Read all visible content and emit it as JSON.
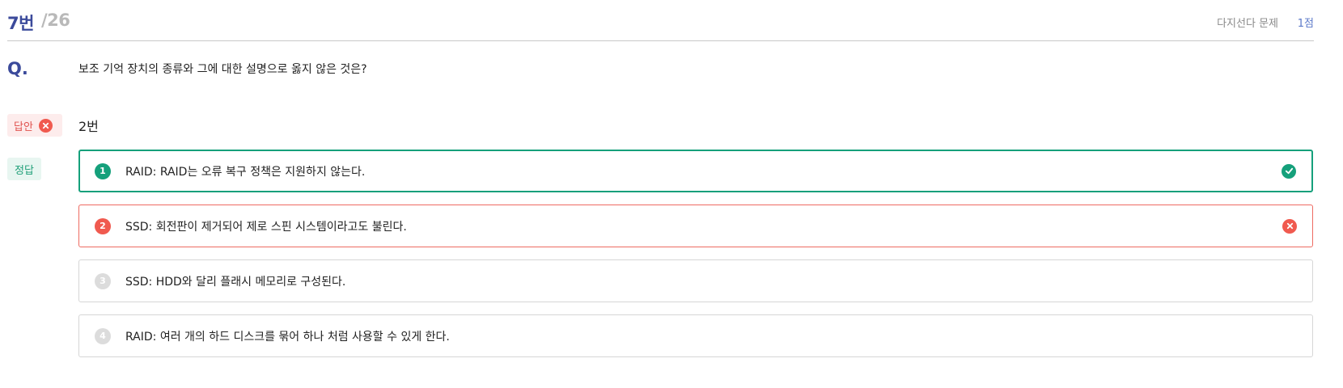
{
  "header": {
    "question_number": "7번",
    "total": "/26",
    "question_type": "다지선다 문제",
    "points": "1점"
  },
  "question": {
    "label": "Q.",
    "text": "보조 기억 장치의 종류와 그에 대한 설명으로 옳지 않은 것은?"
  },
  "answer": {
    "label": "답안",
    "value": "2번",
    "status_icon": "x-circle-icon"
  },
  "correct": {
    "label": "정답"
  },
  "choices": [
    {
      "number": "1",
      "text": "RAID: RAID는 오류 복구 정책은 지원하지 않는다.",
      "state": "correct",
      "icon": "check-circle-icon"
    },
    {
      "number": "2",
      "text": "SSD: 회전판이 제거되어 제로 스핀 시스템이라고도 불린다.",
      "state": "wrong",
      "icon": "x-circle-icon"
    },
    {
      "number": "3",
      "text": "SSD: HDD와 달리 플래시 메모리로 구성된다.",
      "state": "neutral"
    },
    {
      "number": "4",
      "text": "RAID: 여러 개의 하드 디스크를 묶어 하나 처럼 사용할 수 있게 한다.",
      "state": "neutral"
    }
  ],
  "colors": {
    "accent": "#3b4a9b",
    "correct": "#15a07b",
    "wrong": "#f05a4f",
    "points": "#5b79c9"
  }
}
